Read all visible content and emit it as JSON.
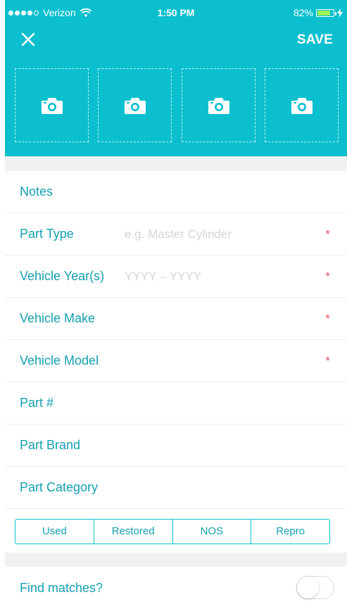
{
  "status_bar": {
    "carrier": "Verizon",
    "time": "1:50 PM",
    "battery": "82%",
    "battery_level": 0.82
  },
  "header": {
    "close_icon": "close-icon",
    "save_label": "SAVE"
  },
  "photos": [
    {
      "icon": "camera-icon"
    },
    {
      "icon": "camera-icon"
    },
    {
      "icon": "camera-icon"
    },
    {
      "icon": "camera-icon"
    }
  ],
  "form": {
    "notes": {
      "label": "Notes"
    },
    "part_type": {
      "label": "Part Type",
      "placeholder": "e.g. Master Cylinder",
      "required_mark": "*"
    },
    "vehicle_years": {
      "label": "Vehicle Year(s)",
      "placeholder": "YYYY – YYYY",
      "required_mark": "*"
    },
    "vehicle_make": {
      "label": "Vehicle Make",
      "required_mark": "*"
    },
    "vehicle_model": {
      "label": "Vehicle Model",
      "required_mark": "*"
    },
    "part_number": {
      "label": "Part #"
    },
    "part_brand": {
      "label": "Part Brand"
    },
    "part_category": {
      "label": "Part Category"
    }
  },
  "condition_options": [
    "Used",
    "Restored",
    "NOS",
    "Repro"
  ],
  "find_matches": {
    "label": "Find matches?",
    "enabled": false
  },
  "colors": {
    "accent": "#0cbfce",
    "label": "#159fb0",
    "required": "#e9535d",
    "placeholder": "#d2d5d8",
    "background": "#f1f1f3"
  }
}
